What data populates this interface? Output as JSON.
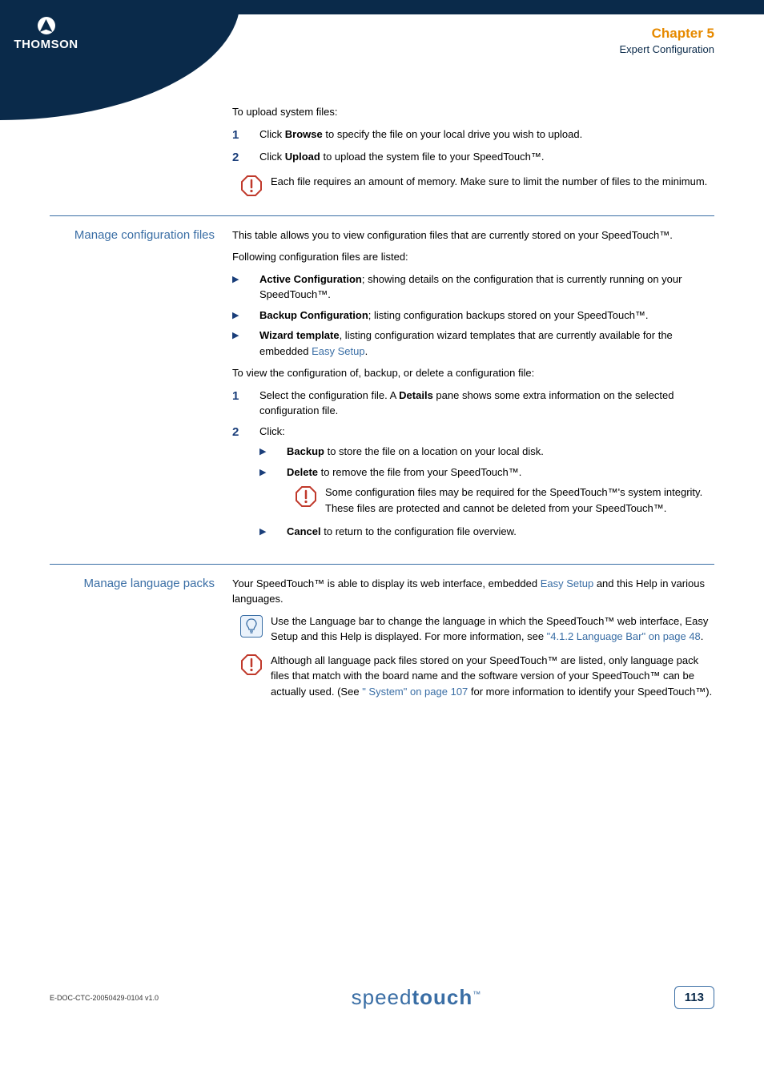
{
  "logo": {
    "text": "THOMSON"
  },
  "header": {
    "chapter": "Chapter 5",
    "subtitle": "Expert Configuration"
  },
  "upload": {
    "intro": "To upload system files:",
    "step1_pre": "Click ",
    "step1_bold": "Browse",
    "step1_post": " to specify the file on your local drive you wish to upload.",
    "step2_pre": "Click ",
    "step2_bold": "Upload",
    "step2_post": " to upload the system file to your SpeedTouch™.",
    "warn": "Each file requires an amount of memory. Make sure to limit the number of files to the minimum."
  },
  "config": {
    "heading": "Manage configuration files",
    "intro": "This table allows you to view configuration files that are currently stored on your SpeedTouch™.",
    "listed": "Following configuration files are listed:",
    "b1_bold": "Active Configuration",
    "b1_rest": "; showing details on the configuration that is currently running on your SpeedTouch™.",
    "b2_bold": "Backup Configuration",
    "b2_rest": "; listing configuration backups stored on your SpeedTouch™.",
    "b3_bold": "Wizard template",
    "b3_rest1": ", listing configuration wizard templates that are currently available for the embedded ",
    "b3_link": "Easy Setup",
    "b3_rest2": ".",
    "view_intro": "To view the configuration of, backup, or delete a configuration file:",
    "s1_pre": "Select the configuration file. A ",
    "s1_bold": "Details",
    "s1_post": " pane shows some extra information on the selected configuration file.",
    "s2": "Click:",
    "sub1_bold": "Backup",
    "sub1_rest": " to store the file on a location on your local disk.",
    "sub2_bold": "Delete",
    "sub2_rest": " to remove the file from your SpeedTouch™.",
    "sub2_warn": "Some configuration files may be required for the SpeedTouch™'s system integrity. These files are protected and cannot be deleted from your SpeedTouch™.",
    "sub3_bold": "Cancel",
    "sub3_rest": " to return to the configuration file overview."
  },
  "lang": {
    "heading": "Manage language packs",
    "intro_pre": "Your SpeedTouch™ is able to display its web interface, embedded ",
    "intro_link": "Easy Setup",
    "intro_post": " and this Help in various languages.",
    "tip_pre": "Use the Language bar to change the language in which the SpeedTouch™ web interface, Easy Setup and this Help is displayed. For more information, see ",
    "tip_link": "\"4.1.2 Language Bar\" on page 48",
    "tip_post": ".",
    "warn_pre": "Although all language pack files stored on your SpeedTouch™ are listed, only language pack files that match with the board name and the software version of your SpeedTouch™ can be actually used. (See ",
    "warn_link": "\" System\" on page 107",
    "warn_post": " for more information to identify your SpeedTouch™)."
  },
  "footer": {
    "doc": "E-DOC-CTC-20050429-0104 v1.0",
    "logo1": "speed",
    "logo2": "touch",
    "tm": "™",
    "page": "113"
  },
  "nums": {
    "n1": "1",
    "n2": "2"
  }
}
